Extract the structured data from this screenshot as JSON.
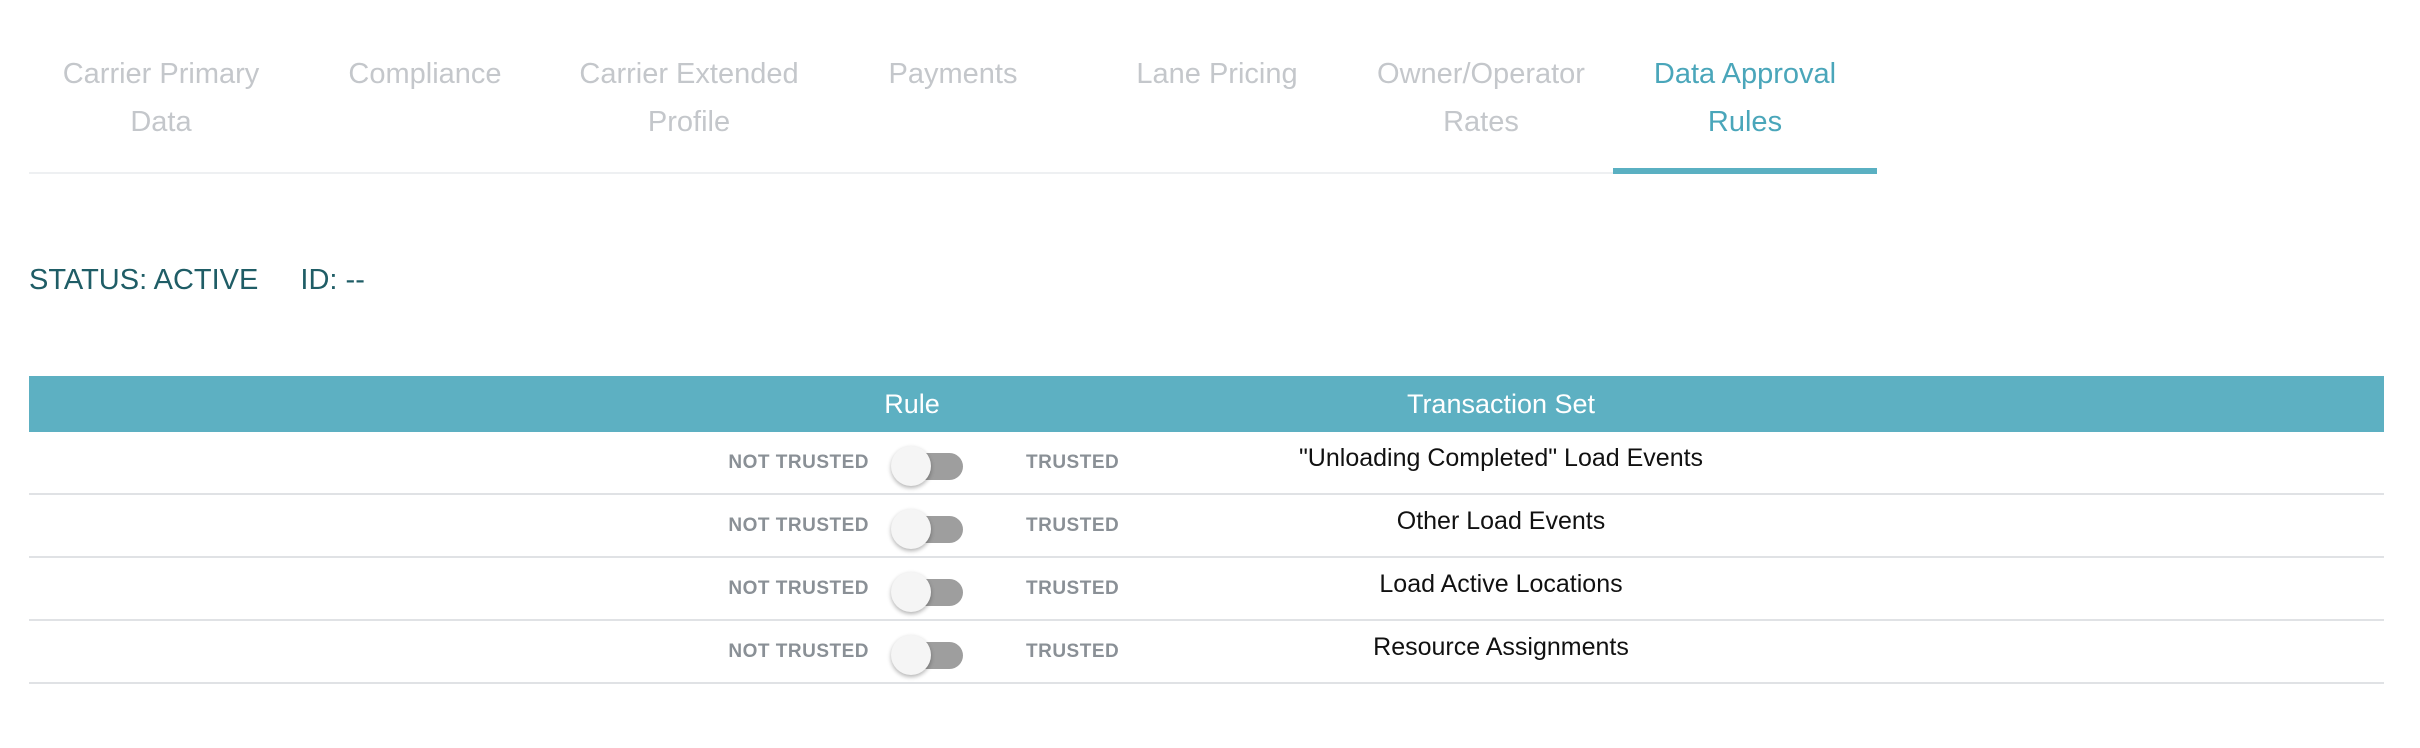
{
  "tabs": [
    {
      "label": "Carrier Primary Data",
      "active": false
    },
    {
      "label": "Compliance",
      "active": false
    },
    {
      "label": "Carrier Extended Profile",
      "active": false
    },
    {
      "label": "Payments",
      "active": false
    },
    {
      "label": "Lane Pricing",
      "active": false
    },
    {
      "label": "Owner/Operator Rates",
      "active": false
    },
    {
      "label": "Data Approval Rules",
      "active": true
    }
  ],
  "status": {
    "status_text": "STATUS: ACTIVE",
    "id_text": "ID: --"
  },
  "table": {
    "headers": {
      "rule": "Rule",
      "transaction_set": "Transaction Set"
    },
    "rows": [
      {
        "not_trusted_label": "NOT TRUSTED",
        "trusted_label": "TRUSTED",
        "trusted": false,
        "transaction_set": "\"Unloading Completed\" Load Events"
      },
      {
        "not_trusted_label": "NOT TRUSTED",
        "trusted_label": "TRUSTED",
        "trusted": false,
        "transaction_set": "Other Load Events"
      },
      {
        "not_trusted_label": "NOT TRUSTED",
        "trusted_label": "TRUSTED",
        "trusted": false,
        "transaction_set": "Load Active Locations"
      },
      {
        "not_trusted_label": "NOT TRUSTED",
        "trusted_label": "TRUSTED",
        "trusted": false,
        "transaction_set": "Resource Assignments"
      }
    ]
  },
  "colors": {
    "accent": "#5db0c2",
    "active_tab_text": "#4aa6ba",
    "inactive_tab_text": "#c4c7cb",
    "status_text": "#1f5d66",
    "toggle_off_track": "#9e9e9e"
  }
}
